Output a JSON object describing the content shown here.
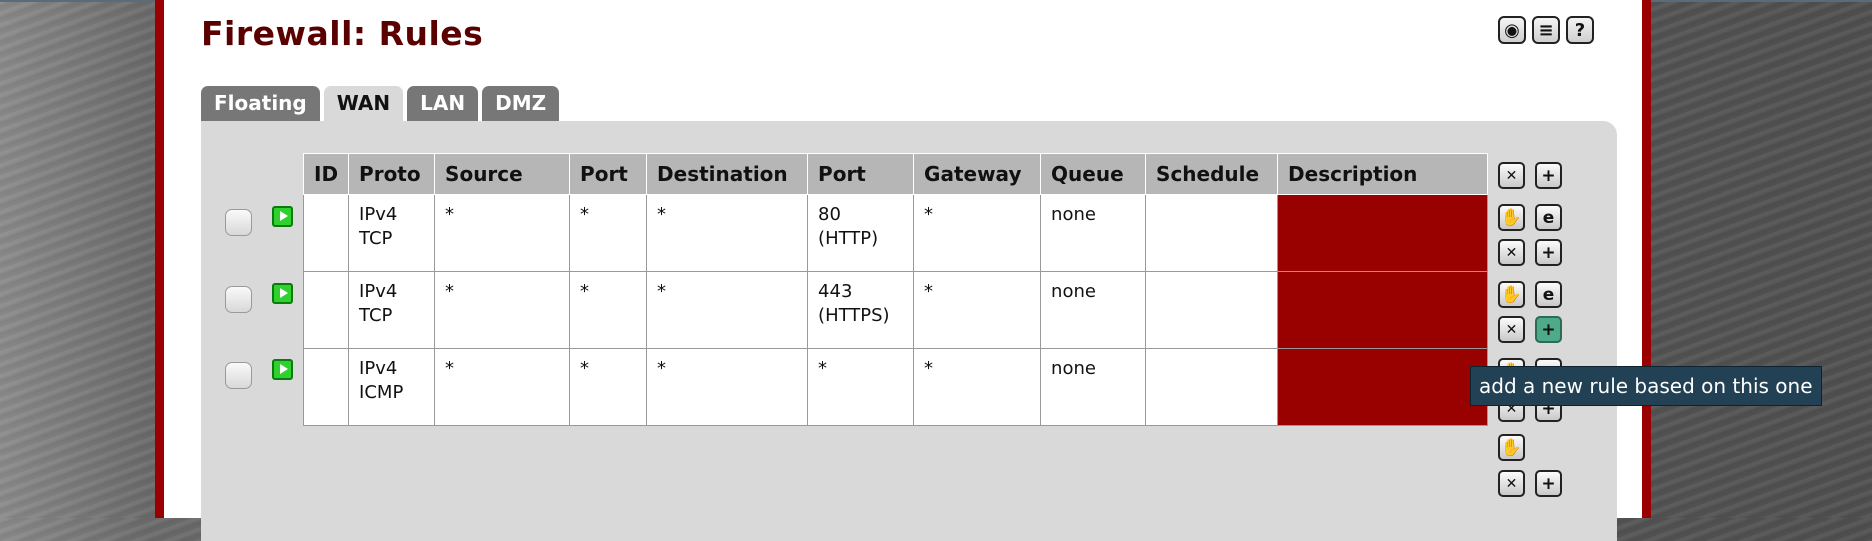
{
  "page": {
    "title": "Firewall: Rules"
  },
  "header_icons": [
    {
      "name": "settings-icon",
      "glyph": "◉"
    },
    {
      "name": "log-icon",
      "glyph": "≡"
    },
    {
      "name": "help-icon",
      "glyph": "?"
    }
  ],
  "tabs": [
    {
      "label": "Floating",
      "active": false
    },
    {
      "label": "WAN",
      "active": true
    },
    {
      "label": "LAN",
      "active": false
    },
    {
      "label": "DMZ",
      "active": false
    }
  ],
  "table": {
    "columns": [
      "ID",
      "Proto",
      "Source",
      "Port",
      "Destination",
      "Port",
      "Gateway",
      "Queue",
      "Schedule",
      "Description"
    ],
    "rows": [
      {
        "id": "",
        "proto": [
          "IPv4",
          "TCP"
        ],
        "source": "*",
        "port": "*",
        "destination": "*",
        "dest_port": [
          "80",
          "(HTTP)"
        ],
        "gateway": "*",
        "queue": "none",
        "schedule": "",
        "description": ""
      },
      {
        "id": "",
        "proto": [
          "IPv4",
          "TCP"
        ],
        "source": "*",
        "port": "*",
        "destination": "*",
        "dest_port": [
          "443",
          "(HTTPS)"
        ],
        "gateway": "*",
        "queue": "none",
        "schedule": "",
        "description": ""
      },
      {
        "id": "",
        "proto": [
          "IPv4",
          "ICMP"
        ],
        "source": "*",
        "port": "*",
        "destination": "*",
        "dest_port": [
          "*",
          ""
        ],
        "gateway": "*",
        "queue": "none",
        "schedule": "",
        "description": ""
      }
    ]
  },
  "tooltip": {
    "text": "add a new rule based on this one"
  },
  "colors": {
    "frame": "#9b0000",
    "title": "#5a0000",
    "description_cell": "#990000",
    "pass_icon": "#2fd12f",
    "tooltip_bg": "#234155"
  }
}
